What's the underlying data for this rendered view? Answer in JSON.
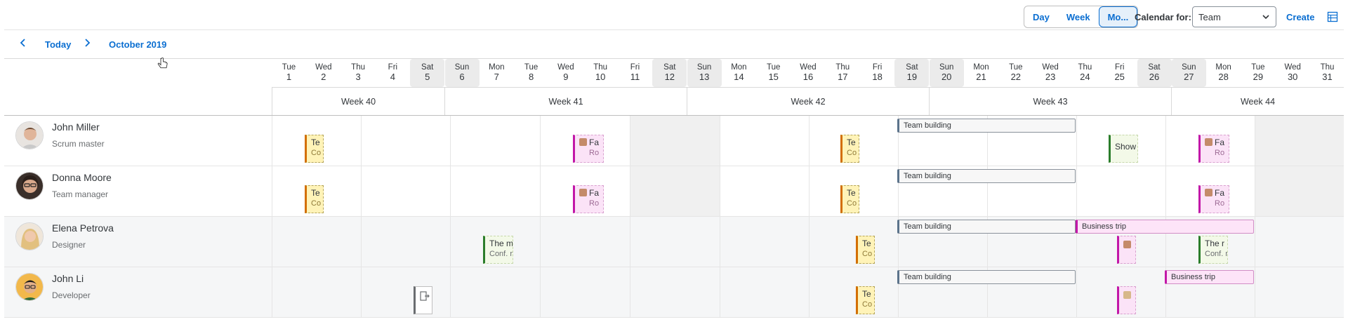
{
  "toolbar": {
    "views": [
      "Day",
      "Week",
      "Mo..."
    ],
    "active_view": "Mo...",
    "calendar_for_label": "Calendar for:",
    "calendar_for_value": "Team",
    "create_label": "Create"
  },
  "nav": {
    "today_label": "Today",
    "month_label": "October 2019"
  },
  "days": [
    {
      "dow": "Tue",
      "num": "1"
    },
    {
      "dow": "Wed",
      "num": "2"
    },
    {
      "dow": "Thu",
      "num": "3"
    },
    {
      "dow": "Fri",
      "num": "4"
    },
    {
      "dow": "Sat",
      "num": "5"
    },
    {
      "dow": "Sun",
      "num": "6"
    },
    {
      "dow": "Mon",
      "num": "7"
    },
    {
      "dow": "Tue",
      "num": "8"
    },
    {
      "dow": "Wed",
      "num": "9"
    },
    {
      "dow": "Thu",
      "num": "10"
    },
    {
      "dow": "Fri",
      "num": "11"
    },
    {
      "dow": "Sat",
      "num": "12"
    },
    {
      "dow": "Sun",
      "num": "13"
    },
    {
      "dow": "Mon",
      "num": "14"
    },
    {
      "dow": "Tue",
      "num": "15"
    },
    {
      "dow": "Wed",
      "num": "16"
    },
    {
      "dow": "Thu",
      "num": "17"
    },
    {
      "dow": "Fri",
      "num": "18"
    },
    {
      "dow": "Sat",
      "num": "19"
    },
    {
      "dow": "Sun",
      "num": "20"
    },
    {
      "dow": "Mon",
      "num": "21"
    },
    {
      "dow": "Tue",
      "num": "22"
    },
    {
      "dow": "Wed",
      "num": "23"
    },
    {
      "dow": "Thu",
      "num": "24"
    },
    {
      "dow": "Fri",
      "num": "25"
    },
    {
      "dow": "Sat",
      "num": "26"
    },
    {
      "dow": "Sun",
      "num": "27"
    },
    {
      "dow": "Mon",
      "num": "28"
    },
    {
      "dow": "Tue",
      "num": "29"
    },
    {
      "dow": "Wed",
      "num": "30"
    },
    {
      "dow": "Thu",
      "num": "31"
    }
  ],
  "weeks": [
    "Week 40",
    "Week 41",
    "Week 42",
    "Week 43",
    "Week 44"
  ],
  "people": [
    {
      "name": "John Miller",
      "role": "Scrum master"
    },
    {
      "name": "Donna Moore",
      "role": "Team manager"
    },
    {
      "name": "Elena Petrova",
      "role": "Designer"
    },
    {
      "name": "John Li",
      "role": "Developer"
    }
  ],
  "appointments": {
    "te_title": "Te",
    "te_sub": "Co",
    "fa_title": "Fa",
    "fa_sub": "Ro",
    "show_title": "Show",
    "the_title": "The m",
    "the_sub": "Conf. r",
    "the_title_short": "The r",
    "the_sub_short": "Conf. r",
    "team_building": "Team building",
    "business_trip": "Business trip"
  },
  "colors": {
    "accent": "#0a6ed1",
    "orange": "#d36f00",
    "pink": "#c217a8",
    "green": "#2b7d2b"
  }
}
